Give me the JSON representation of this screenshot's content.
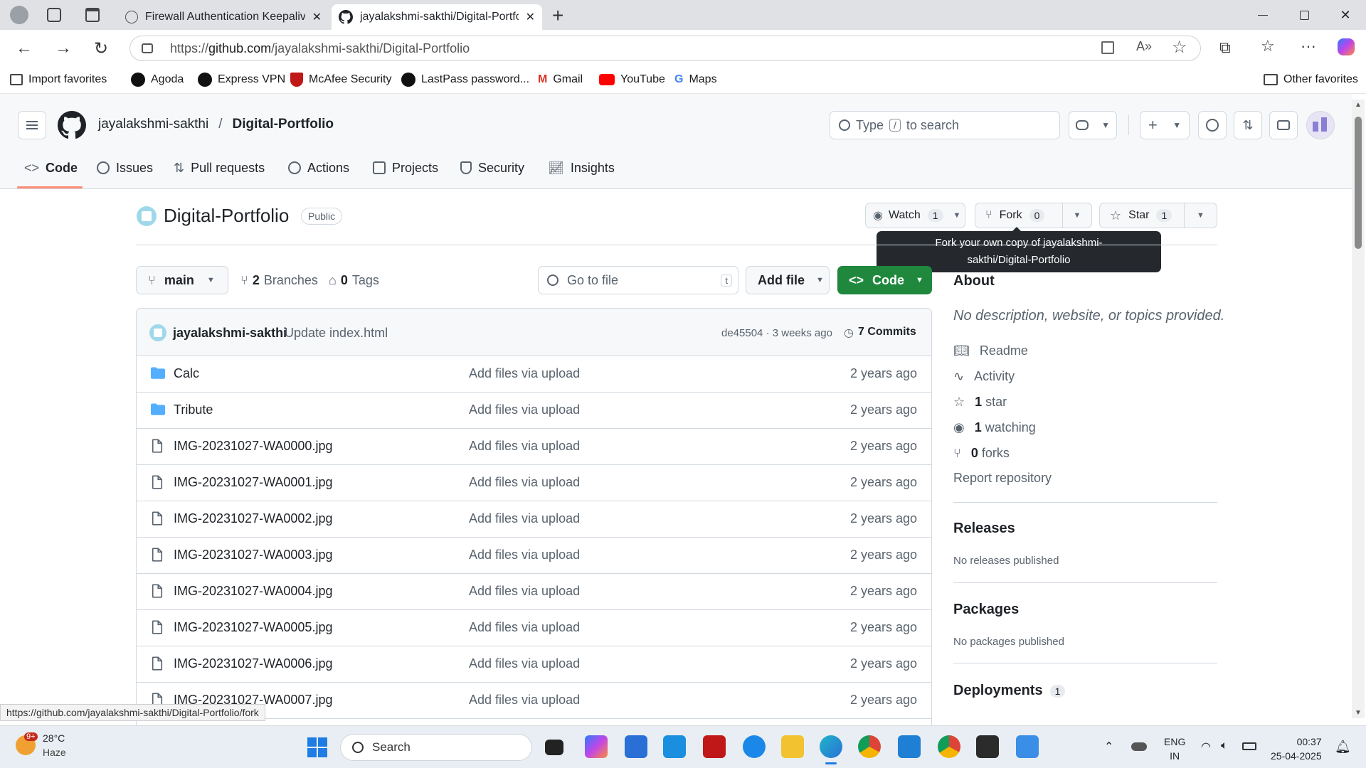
{
  "browser": {
    "tabs": [
      {
        "title": "Firewall Authentication Keepalive",
        "active": false
      },
      {
        "title": "jayalakshmi-sakthi/Digital-Portfolio",
        "active": true
      }
    ],
    "url_prefix": "https://",
    "url_host": "github.com",
    "url_path": "/jayalakshmi-sakthi/Digital-Portfolio",
    "favorites": [
      "Import favorites",
      "Agoda",
      "Express VPN",
      "McAfee Security",
      "LastPass password...",
      "Gmail",
      "YouTube",
      "Maps"
    ],
    "other_favorites": "Other favorites"
  },
  "github": {
    "owner": "jayalakshmi-sakthi",
    "separator": "/",
    "repo": "Digital-Portfolio",
    "search_type": "Type",
    "search_key": "/",
    "search_rest": "to search",
    "nav_tabs": [
      "Code",
      "Issues",
      "Pull requests",
      "Actions",
      "Projects",
      "Security",
      "Insights"
    ]
  },
  "repo": {
    "name": "Digital-Portfolio",
    "visibility": "Public",
    "watch_label": "Watch",
    "watch_count": "1",
    "fork_label": "Fork",
    "fork_count": "0",
    "star_label": "Star",
    "star_count": "1",
    "tooltip_line1": "Fork your own copy of jayalakshmi-",
    "tooltip_line2": "sakthi/Digital-Portfolio",
    "branch": "main",
    "branches_count": "2",
    "branches_label": "Branches",
    "tags_count": "0",
    "tags_label": "Tags",
    "go_to_file": "Go to file",
    "go_to_file_key": "t",
    "add_file": "Add file",
    "code_button": "Code"
  },
  "commit": {
    "author": "jayalakshmi-sakthi",
    "message": "Update index.html",
    "hash_time": "de45504 · 3 weeks ago",
    "commits": "7 Commits"
  },
  "files": [
    {
      "name": "Calc",
      "type": "folder",
      "message": "Add files via upload",
      "age": "2 years ago"
    },
    {
      "name": "Tribute",
      "type": "folder",
      "message": "Add files via upload",
      "age": "2 years ago"
    },
    {
      "name": "IMG-20231027-WA0000.jpg",
      "type": "file",
      "message": "Add files via upload",
      "age": "2 years ago"
    },
    {
      "name": "IMG-20231027-WA0001.jpg",
      "type": "file",
      "message": "Add files via upload",
      "age": "2 years ago"
    },
    {
      "name": "IMG-20231027-WA0002.jpg",
      "type": "file",
      "message": "Add files via upload",
      "age": "2 years ago"
    },
    {
      "name": "IMG-20231027-WA0003.jpg",
      "type": "file",
      "message": "Add files via upload",
      "age": "2 years ago"
    },
    {
      "name": "IMG-20231027-WA0004.jpg",
      "type": "file",
      "message": "Add files via upload",
      "age": "2 years ago"
    },
    {
      "name": "IMG-20231027-WA0005.jpg",
      "type": "file",
      "message": "Add files via upload",
      "age": "2 years ago"
    },
    {
      "name": "IMG-20231027-WA0006.jpg",
      "type": "file",
      "message": "Add files via upload",
      "age": "2 years ago"
    },
    {
      "name": "IMG-20231027-WA0007.jpg",
      "type": "file",
      "message": "Add files via upload",
      "age": "2 years ago"
    }
  ],
  "about": {
    "heading": "About",
    "description": "No description, website, or topics provided.",
    "readme": "Readme",
    "activity": "Activity",
    "stars_count": "1",
    "stars_label": "star",
    "watching_count": "1",
    "watching_label": "watching",
    "forks_count": "0",
    "forks_label": "forks",
    "report": "Report repository",
    "releases_heading": "Releases",
    "releases_text": "No releases published",
    "packages_heading": "Packages",
    "packages_text": "No packages published",
    "deployments_heading": "Deployments",
    "deployments_count": "1"
  },
  "status_url": "https://github.com/jayalakshmi-sakthi/Digital-Portfolio/fork",
  "taskbar": {
    "weather_temp": "28°C",
    "weather_desc": "Haze",
    "weather_badge": "9+",
    "search": "Search",
    "lang_line1": "ENG",
    "lang_line2": "IN",
    "time": "00:37",
    "date": "25-04-2025"
  },
  "colors": {
    "accent_green": "#1f883d",
    "tab_underline": "#fd8c73",
    "link_blue": "#0969da",
    "folder_blue": "#54aeff"
  }
}
